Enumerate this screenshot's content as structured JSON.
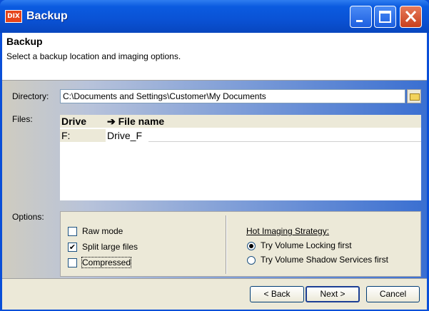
{
  "window": {
    "title": "Backup",
    "app_icon_text": "DIX"
  },
  "header": {
    "title": "Backup",
    "subtitle": "Select a backup location and imaging options."
  },
  "directory": {
    "label": "Directory:",
    "value": "C:\\Documents and Settings\\Customer\\My Documents"
  },
  "files": {
    "label": "Files:",
    "columns": [
      "Drive",
      "➔ File name"
    ],
    "rows": [
      {
        "drive": "F:",
        "file_name": "Drive_F"
      }
    ]
  },
  "options": {
    "label": "Options:",
    "checkboxes": [
      {
        "label": "Raw mode",
        "checked": false
      },
      {
        "label": "Split large files",
        "checked": true
      },
      {
        "label": "Compressed",
        "checked": false
      }
    ],
    "hot_imaging": {
      "title": "Hot Imaging Strategy:",
      "choices": [
        {
          "label": "Try Volume Locking first",
          "selected": true
        },
        {
          "label": "Try Volume Shadow Services first",
          "selected": false
        }
      ]
    }
  },
  "buttons": {
    "back": "< Back",
    "next": "Next >",
    "cancel": "Cancel"
  },
  "colors": {
    "titlebar": "#0a52d5",
    "close_button": "#c8401c",
    "dialog_face": "#ece9d8"
  }
}
